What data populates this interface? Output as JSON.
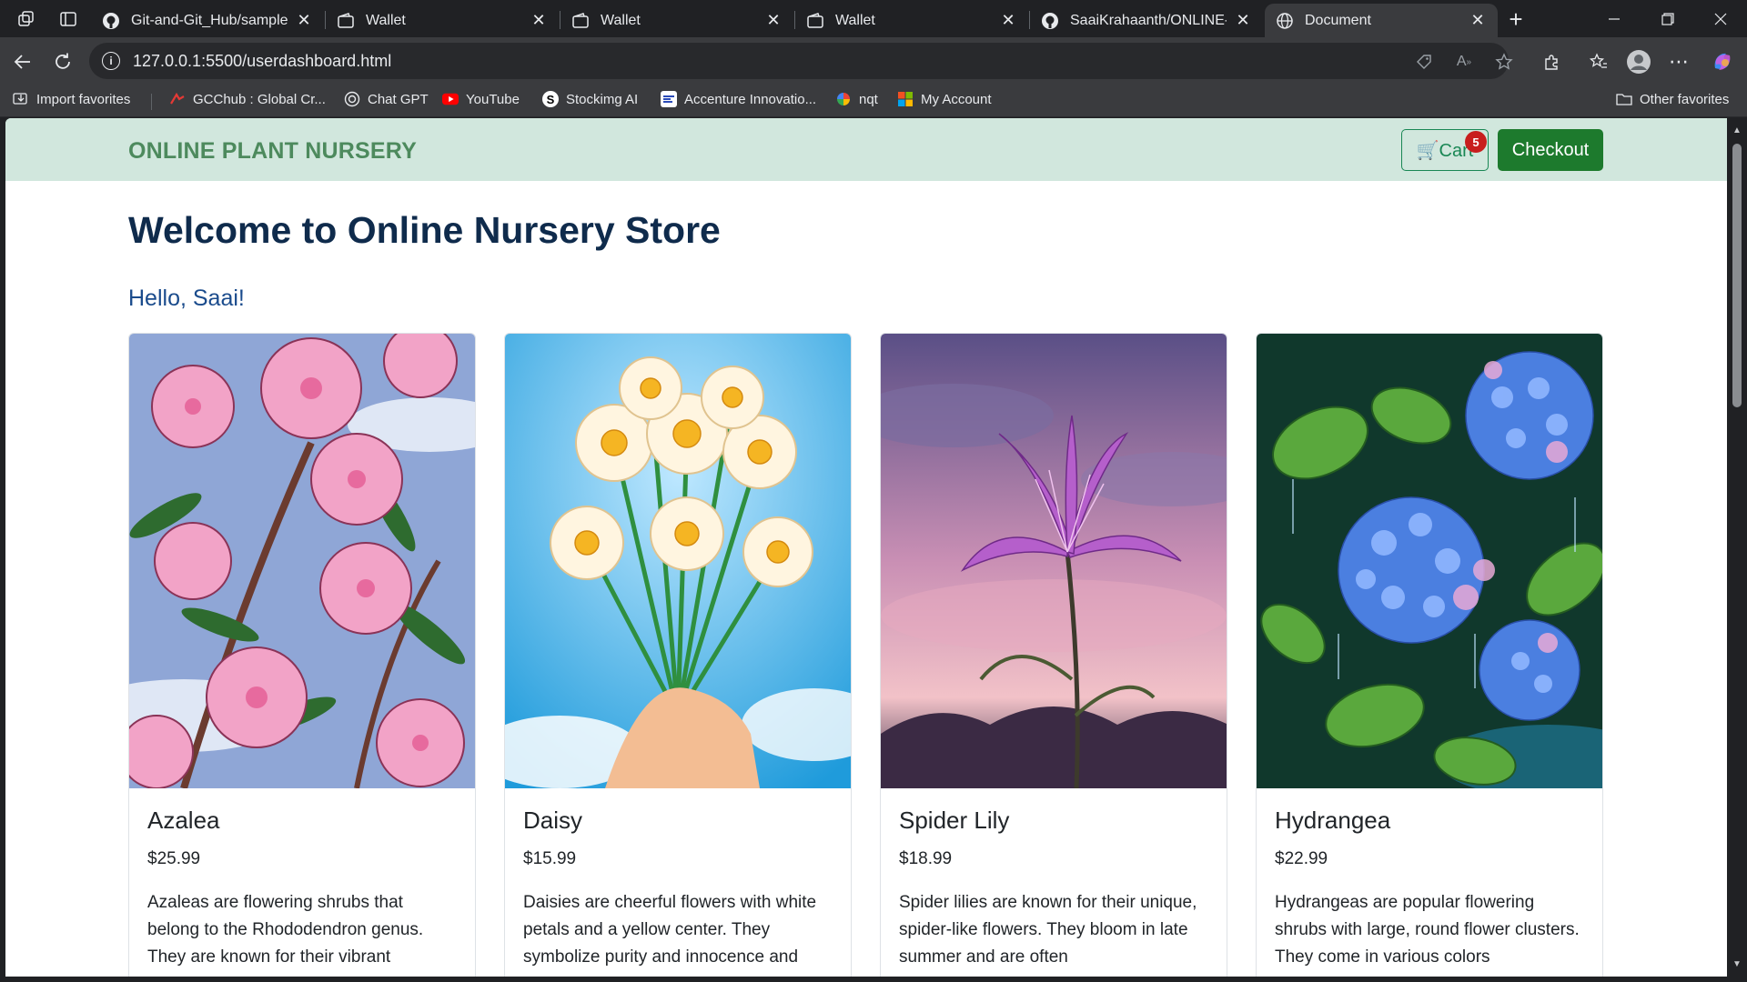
{
  "browser": {
    "tabs": [
      {
        "title": "Git-and-Git_Hub/sample.ht",
        "icon": "github-icon"
      },
      {
        "title": "Wallet",
        "icon": "wallet-icon"
      },
      {
        "title": "Wallet",
        "icon": "wallet-icon"
      },
      {
        "title": "Wallet",
        "icon": "wallet-icon"
      },
      {
        "title": "SaaiKrahaanth/ONLINE-PL/",
        "icon": "github-icon"
      },
      {
        "title": "Document",
        "icon": "globe-icon",
        "active": true
      }
    ],
    "url": "127.0.0.1:5500/userdashboard.html",
    "favorites": [
      {
        "label": "Import favorites",
        "icon": "import-icon"
      },
      {
        "label": "GCChub : Global Cr...",
        "icon": "gcc-icon"
      },
      {
        "label": "Chat GPT",
        "icon": "chatgpt-icon"
      },
      {
        "label": "YouTube",
        "icon": "youtube-icon"
      },
      {
        "label": "Stockimg AI",
        "icon": "stockimg-icon"
      },
      {
        "label": "Accenture Innovatio...",
        "icon": "accenture-icon"
      },
      {
        "label": "nqt",
        "icon": "nqt-icon"
      },
      {
        "label": "My Account",
        "icon": "microsoft-icon"
      }
    ],
    "other_favorites": "Other favorites"
  },
  "page": {
    "brand": "ONLINE PLANT NURSERY",
    "cart_label": "🛒Cart",
    "cart_count": "5",
    "checkout_label": "Checkout",
    "title": "Welcome to Online Nursery Store",
    "greeting": "Hello, Saai!",
    "products": [
      {
        "name": "Azalea",
        "price": "$25.99",
        "description": "Azaleas are flowering shrubs that belong to the Rhododendron genus. They are known for their vibrant"
      },
      {
        "name": "Daisy",
        "price": "$15.99",
        "description": "Daisies are cheerful flowers with white petals and a yellow center. They symbolize purity and innocence and"
      },
      {
        "name": "Spider Lily",
        "price": "$18.99",
        "description": "Spider lilies are known for their unique, spider-like flowers. They bloom in late summer and are often"
      },
      {
        "name": "Hydrangea",
        "price": "$22.99",
        "description": "Hydrangeas are popular flowering shrubs with large, round flower clusters. They come in various colors"
      }
    ]
  },
  "colors": {
    "navbar_bg": "#d1e7dd",
    "brand": "#4d8a5d",
    "checkout_bg": "#1d7a2d",
    "title": "#0f2b4c",
    "greeting": "#1a4b8c",
    "badge": "#c81e1e"
  }
}
